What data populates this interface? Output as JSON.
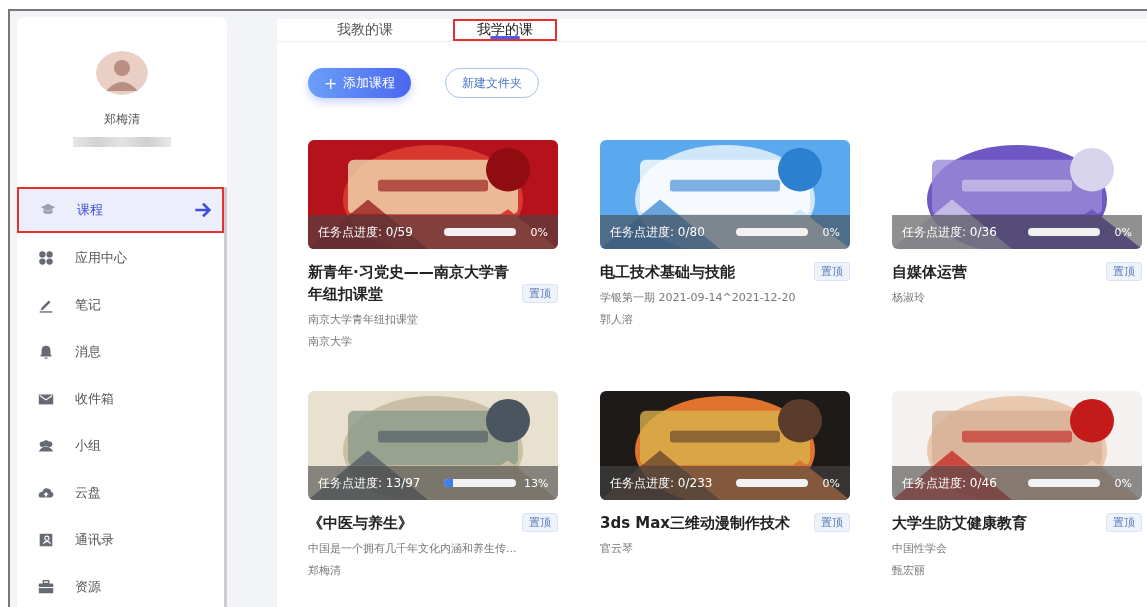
{
  "user": {
    "name": "郑梅清"
  },
  "sidebar": {
    "items": [
      {
        "label": "课程",
        "selected": true
      },
      {
        "label": "应用中心",
        "selected": false
      },
      {
        "label": "笔记",
        "selected": false
      },
      {
        "label": "消息",
        "selected": false
      },
      {
        "label": "收件箱",
        "selected": false
      },
      {
        "label": "小组",
        "selected": false
      },
      {
        "label": "云盘",
        "selected": false
      },
      {
        "label": "通讯录",
        "selected": false
      },
      {
        "label": "资源",
        "selected": false
      }
    ]
  },
  "tabs": [
    {
      "label": "我教的课",
      "selected": false
    },
    {
      "label": "我学的课",
      "selected": true
    }
  ],
  "actions": {
    "add": "添加课程",
    "add_icon": "+",
    "folder": "新建文件夹"
  },
  "courses": [
    {
      "title": "新青年·习党史——南京大学青年纽扣课堂",
      "pin": "置顶",
      "progress": "任务点进度: 0/59",
      "level": 0,
      "percent": "0%",
      "lines": [
        "南京大学青年纽扣课堂",
        "南京大学"
      ]
    },
    {
      "title": "电工技术基础与技能",
      "pin": "置顶",
      "progress": "任务点进度: 0/80",
      "level": 0,
      "percent": "0%",
      "lines": [
        "学银第一期  2021-09-14^2021-12-20",
        "郭人溶"
      ]
    },
    {
      "title": "自媒体运营",
      "pin": "置顶",
      "progress": "任务点进度: 0/36",
      "level": 0,
      "percent": "0%",
      "lines": [
        "杨淑玲"
      ]
    },
    {
      "title": "《中医与养生》",
      "pin": "置顶",
      "progress": "任务点进度: 13/97",
      "level": 0.13,
      "percent": "13%",
      "lines": [
        "中国是一个拥有几千年文化内涵和养生传...",
        "郑梅清"
      ]
    },
    {
      "title": "3ds Max三维动漫制作技术",
      "pin": "置顶",
      "progress": "任务点进度: 0/233",
      "level": 0,
      "percent": "0%",
      "lines": [
        "官云琴"
      ]
    },
    {
      "title": "大学生防艾健康教育",
      "pin": "置顶",
      "progress": "任务点进度: 0/46",
      "level": 0,
      "percent": "0%",
      "lines": [
        "中国性学会",
        "甄宏丽"
      ]
    }
  ]
}
